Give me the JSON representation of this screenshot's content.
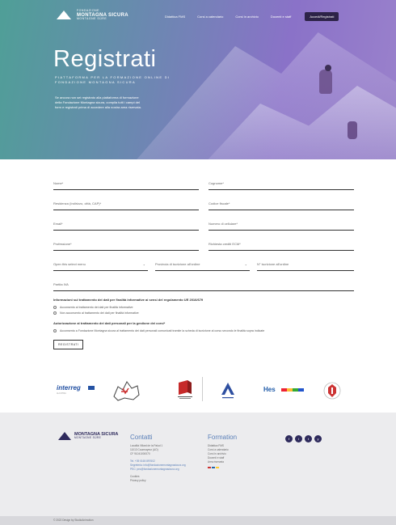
{
  "header": {
    "logo": {
      "line1": "FONDAZIONE",
      "line2": "MONTAGNA SICURA",
      "line3": "MONTAGNE SÛRE"
    },
    "nav": [
      "Didattica FMS",
      "Corsi a calendario",
      "Corsi in archivio",
      "Docenti e staff"
    ],
    "cta": "Accedi/Registrati"
  },
  "hero": {
    "title": "Registrati",
    "subtitle_line1": "Piattaforma per la formazione online di",
    "subtitle_line2": "Fondazione Montagna sicura",
    "description": "Se ancora non sei registrato alla piattaforma di formazione della Fondazione Montagna sicura, compila tutti i campi del form e registrati prima di accedere alla nostra area riservata."
  },
  "form": {
    "nome": "Nome*",
    "cognome": "Cognome*",
    "residenza": "Residenza (Indirizzo, città, CAP)*",
    "codice_fiscale": "Codice fiscale*",
    "email": "Email*",
    "telefono": "Numero di cellulare*",
    "professione": "Professione*",
    "crediti": "Richiesta crediti ECM*",
    "select1": "Open this select menu",
    "select2": "Provincia di iscrizione all'ordine",
    "select3": "N° iscrizione all'ordine",
    "partita_iva": "Partita IVA",
    "privacy_title": "Informazioni sul trattamento dei dati per finalità informative ai sensi del regolamento UE 2016/679",
    "privacy_yes": "Acconsento al trattamento dei dati per finalità informative",
    "privacy_no": "Non acconsento al trattamento dei dati per finalità informative",
    "auth_title": "Autorizzazione al trattamento dei dati personali per la gestione dei corsi*",
    "auth_text": "Acconsento a Fondazione Montagna sicura al trattamento dei dati personali comunicati tramite la scheda di iscrizione al corso secondo le finalità sopra indicate",
    "submit": "REGISTRATI"
  },
  "partners": {
    "interreg": "interreg",
    "interreg_sub": "ALCOTRA",
    "hes": "Hes"
  },
  "footer": {
    "logo_a": "MONTAGNA SICURA",
    "logo_b": "MONTAGNE SÛRE",
    "contatti_title": "Contatti",
    "contatti_lines": [
      "Località Villard de la Palud 1",
      "11013 Courmayeur (AO)",
      "CF 91041000070"
    ],
    "contatti_tel": "Tel. +39 0165 897602",
    "contatti_mail": "Segreteria: info@fondazionemontagnasicura.org",
    "contatti_pec": "PEC: pec@fondazionemontagnasicura.org",
    "contatti_extra": [
      "Cookies",
      "Privacy policy"
    ],
    "formation_title": "Formation",
    "formation_lines": [
      "Didattica FMS",
      "Corsi a calendario",
      "Corsi in archivio",
      "Docenti e staff",
      "Area riservata"
    ],
    "social": [
      "f",
      "i",
      "t",
      "y"
    ]
  },
  "bottom": {
    "text": "© 2022 Design by StudioAnimotion"
  }
}
